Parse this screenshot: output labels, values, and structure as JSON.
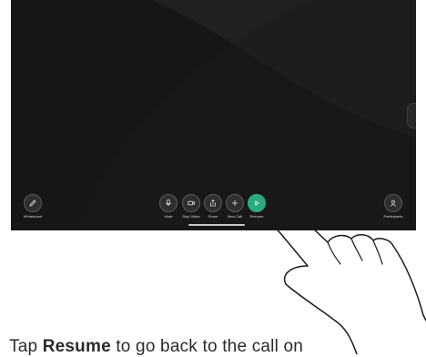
{
  "controls": {
    "whiteboard": {
      "label": "Whiteboard",
      "icon": "pen-icon"
    },
    "mute": {
      "label": "Mute",
      "icon": "microphone-icon"
    },
    "stop_video": {
      "label": "Stop Video",
      "icon": "video-camera-icon"
    },
    "share": {
      "label": "Share",
      "icon": "share-icon"
    },
    "new_call": {
      "label": "New Call",
      "icon": "plus-icon"
    },
    "resume": {
      "label": "Resume",
      "icon": "play-icon"
    },
    "participants": {
      "label": "Participants",
      "icon": "person-icon"
    }
  },
  "caption": {
    "prefix": "Tap ",
    "emphasis": "Resume",
    "suffix": " to go back to the call on"
  },
  "colors": {
    "screen_background": "#161616",
    "resume_button": "#2bab7d"
  }
}
